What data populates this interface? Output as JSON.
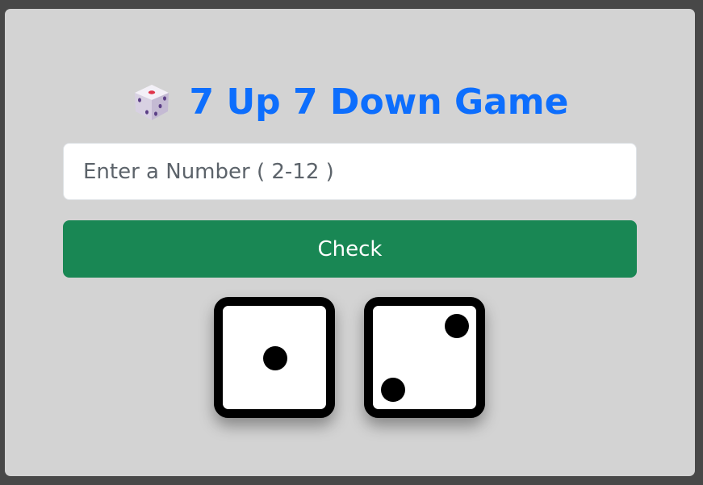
{
  "title": {
    "icon": "game-die-icon",
    "text": "7 Up 7 Down Game"
  },
  "number_input": {
    "placeholder": "Enter a Number ( 2-12 )",
    "value": ""
  },
  "check_button": {
    "label": "Check"
  },
  "dice": [
    {
      "value": 1
    },
    {
      "value": 2
    }
  ],
  "colors": {
    "title": "#0d6efd",
    "check_button": "#198754",
    "card_background": "#d3d3d3",
    "page_background": "#484848"
  }
}
